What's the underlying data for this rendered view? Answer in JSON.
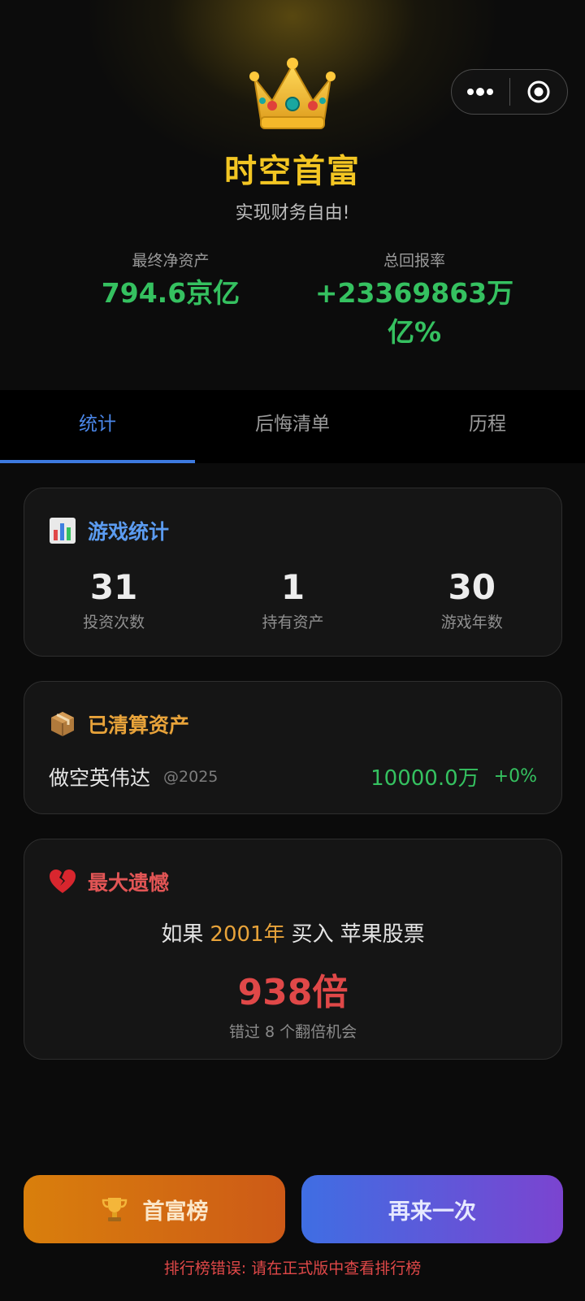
{
  "header": {
    "crown_icon": "crown-icon",
    "title": "时空首富",
    "subtitle": "实现财务自由!",
    "capsule": {
      "more_icon": "more-dots-icon",
      "close_icon": "target-close-icon"
    }
  },
  "summary": {
    "net_assets_label": "最终净资产",
    "net_assets_value": "794.6京亿",
    "return_label": "总回报率",
    "return_value": "+23369863万亿%"
  },
  "tabs": [
    {
      "label": "统计",
      "active": true
    },
    {
      "label": "后悔清单",
      "active": false
    },
    {
      "label": "历程",
      "active": false
    }
  ],
  "game_stats": {
    "icon": "bar-chart-icon",
    "title": "游戏统计",
    "items": [
      {
        "value": "31",
        "label": "投资次数"
      },
      {
        "value": "1",
        "label": "持有资产"
      },
      {
        "value": "30",
        "label": "游戏年数"
      }
    ]
  },
  "liquidated": {
    "icon": "package-icon",
    "title": "已清算资产",
    "asset": {
      "name": "做空英伟达",
      "year": "@2025",
      "amount": "10000.0万",
      "change": "+0%"
    }
  },
  "regret": {
    "icon": "broken-heart-icon",
    "title": "最大遗憾",
    "if_text": "如果",
    "year": "2001年",
    "buy_text": "买入",
    "stock": "苹果股票",
    "multiple": "938倍",
    "note": "错过 8 个翻倍机会"
  },
  "buttons": {
    "rank_icon": "trophy-icon",
    "rank_label": "首富榜",
    "again_label": "再来一次"
  },
  "error_text": "排行榜错误: 请在正式版中查看排行榜",
  "colors": {
    "gold": "#f3c623",
    "green": "#35c160",
    "blue": "#4a86e8",
    "red": "#e04848",
    "orange": "#e8a33a"
  }
}
